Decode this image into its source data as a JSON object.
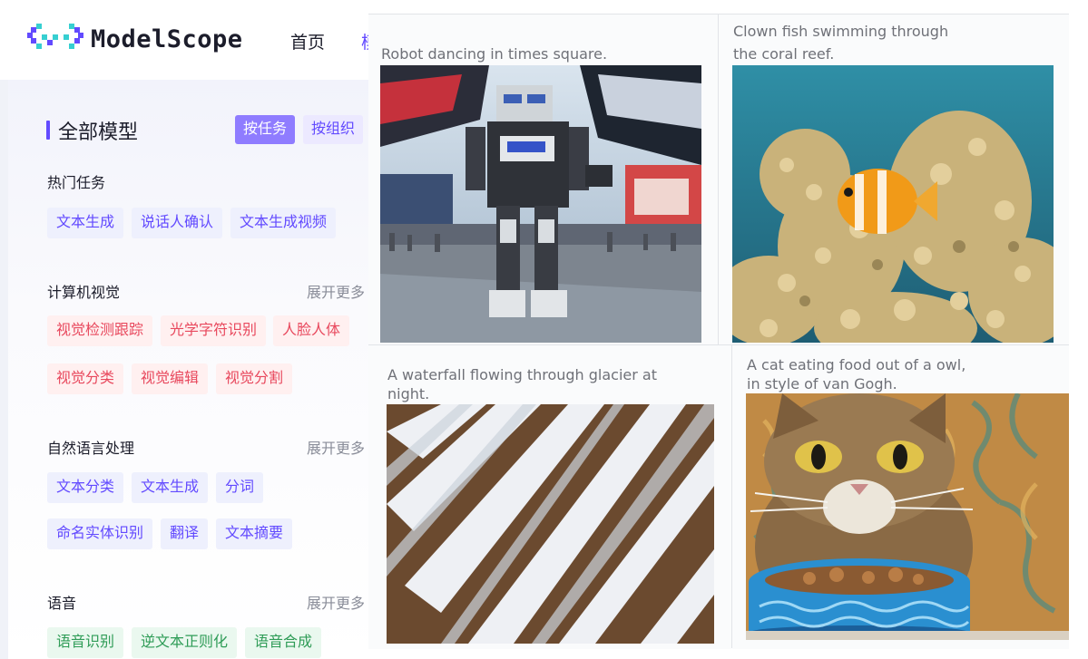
{
  "header": {
    "brand": "ModelScope",
    "nav_home": "首页",
    "nav_cut": "模"
  },
  "sidebar": {
    "title": "全部模型",
    "btn_by_task": "按任务",
    "btn_by_org": "按组织",
    "more_label": "展开更多",
    "hot": {
      "title": "热门任务",
      "tags": [
        "文本生成",
        "说话人确认",
        "文本生成视频"
      ]
    },
    "cv": {
      "title": "计算机视觉",
      "tags": [
        "视觉检测跟踪",
        "光学字符识别",
        "人脸人体",
        "视觉分类",
        "视觉编辑",
        "视觉分割"
      ]
    },
    "nlp": {
      "title": "自然语言处理",
      "tags": [
        "文本分类",
        "文本生成",
        "分词",
        "命名实体识别",
        "翻译",
        "文本摘要"
      ]
    },
    "audio": {
      "title": "语音",
      "tags": [
        "语音识别",
        "逆文本正则化",
        "语音合成"
      ]
    }
  },
  "gallery": [
    {
      "caption": "Robot dancing in times square.",
      "image": "robot-times-square"
    },
    {
      "caption_lines": [
        "Clown fish swimming through",
        "the coral reef."
      ],
      "image": "clownfish-coral"
    },
    {
      "caption_lines": [
        "A waterfall flowing through glacier at",
        "night."
      ],
      "image": "waterfall-glacier"
    },
    {
      "caption_lines": [
        "A cat eating food out of a owl,",
        "in style of van Gogh."
      ],
      "image": "cat-bowl-van-gogh"
    }
  ],
  "colors": {
    "accent": "#624aff",
    "tag_blue_bg": "#eef0fd",
    "tag_red_bg": "#fff0f0",
    "tag_red_fg": "#e8485d",
    "tag_green_bg": "#eaf8ef",
    "tag_green_fg": "#2f9c57"
  }
}
